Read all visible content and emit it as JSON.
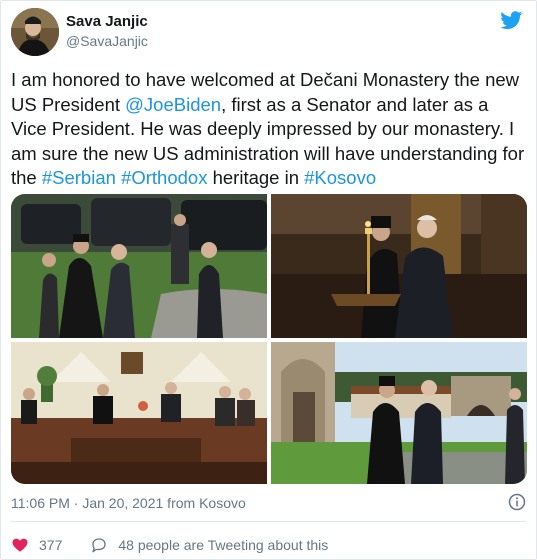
{
  "user": {
    "name": "Sava Janjic",
    "handle": "@SavaJanjic"
  },
  "tweet": {
    "segments": [
      {
        "text": "I am honored to have welcomed at Dečani Monastery the new US President ",
        "link": false
      },
      {
        "text": "@JoeBiden",
        "link": true
      },
      {
        "text": ", first as a Senator and later as a Vice President. He was deeply impressed by our monastery. I am sure the new US administration will have understanding for the ",
        "link": false
      },
      {
        "text": "#Serbian",
        "link": true
      },
      {
        "text": " ",
        "link": false
      },
      {
        "text": "#Orthodox",
        "link": true
      },
      {
        "text": " heritage in ",
        "link": false
      },
      {
        "text": "#Kosovo",
        "link": true
      }
    ]
  },
  "meta": {
    "timestamp": "11:06 PM · Jan 20, 2021 from Kosovo"
  },
  "actions": {
    "likes": "377",
    "people_tweeting": "48 people are Tweeting about this"
  },
  "colors": {
    "link": "#1b95e0",
    "heart": "#e0245e",
    "secondary": "#657786"
  },
  "icons": [
    "twitter-bird-icon",
    "info-icon",
    "heart-icon",
    "chat-bubble-icon"
  ]
}
